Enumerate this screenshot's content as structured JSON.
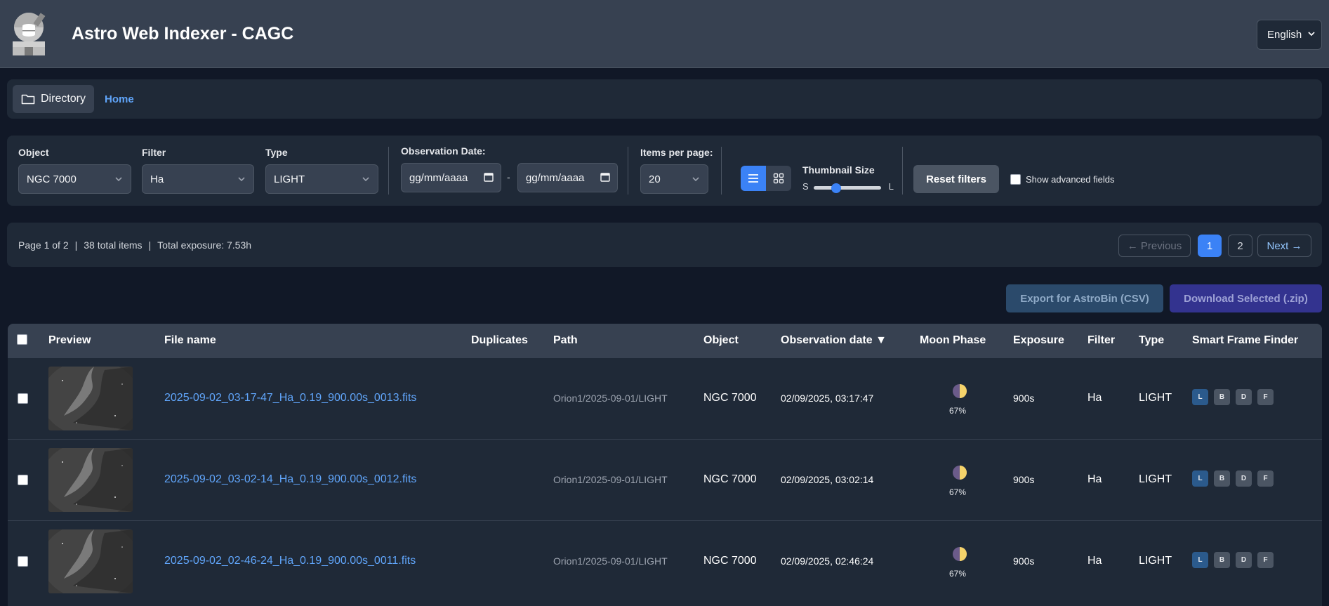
{
  "header": {
    "title": "Astro Web Indexer - CAGC",
    "language": "English"
  },
  "breadcrumb": {
    "directory_label": "Directory",
    "home_label": "Home"
  },
  "filters": {
    "object_label": "Object",
    "object_value": "NGC 7000",
    "filter_label": "Filter",
    "filter_value": "Ha",
    "type_label": "Type",
    "type_value": "LIGHT",
    "date_label": "Observation Date:",
    "date_from_placeholder": "gg/mm/aaaa",
    "date_to_placeholder": "gg/mm/aaaa",
    "date_separator": "-",
    "items_label": "Items per page:",
    "items_value": "20",
    "thumb_label": "Thumbnail Size",
    "thumb_small": "S",
    "thumb_large": "L",
    "thumb_level": 0.3,
    "reset_label": "Reset filters",
    "advanced_label": "Show advanced fields"
  },
  "pagination": {
    "page_info": "Page 1 of 2",
    "total_items": "38 total items",
    "total_exposure": "Total exposure: 7.53h",
    "sep": "|",
    "prev_label": "← Previous",
    "page1": "1",
    "page2": "2",
    "next_label": "Next →"
  },
  "actions": {
    "export_label": "Export for AstroBin (CSV)",
    "download_label": "Download Selected (.zip)"
  },
  "table": {
    "headers": {
      "preview": "Preview",
      "file_name": "File name",
      "duplicates": "Duplicates",
      "path": "Path",
      "object": "Object",
      "obs_date": "Observation date ▼",
      "moon": "Moon Phase",
      "exposure": "Exposure",
      "filter": "Filter",
      "type": "Type",
      "sff": "Smart Frame Finder"
    },
    "rows": [
      {
        "file": "2025-09-02_03-17-47_Ha_0.19_900.00s_0013.fits",
        "path": "Orion1/2025-09-01/LIGHT",
        "object": "NGC 7000",
        "date": "02/09/2025, 03:17:47",
        "moon": "67%",
        "exposure": "900s",
        "filter": "Ha",
        "type": "LIGHT"
      },
      {
        "file": "2025-09-02_03-02-14_Ha_0.19_900.00s_0012.fits",
        "path": "Orion1/2025-09-01/LIGHT",
        "object": "NGC 7000",
        "date": "02/09/2025, 03:02:14",
        "moon": "67%",
        "exposure": "900s",
        "filter": "Ha",
        "type": "LIGHT"
      },
      {
        "file": "2025-09-02_02-46-24_Ha_0.19_900.00s_0011.fits",
        "path": "Orion1/2025-09-01/LIGHT",
        "object": "NGC 7000",
        "date": "02/09/2025, 02:46:24",
        "moon": "67%",
        "exposure": "900s",
        "filter": "Ha",
        "type": "LIGHT"
      }
    ],
    "sff_buttons": [
      "L",
      "B",
      "D",
      "F"
    ]
  },
  "colors": {
    "accent": "#3b82f6",
    "link": "#60a5fa",
    "background": "#111827",
    "panel": "#1f2937"
  }
}
